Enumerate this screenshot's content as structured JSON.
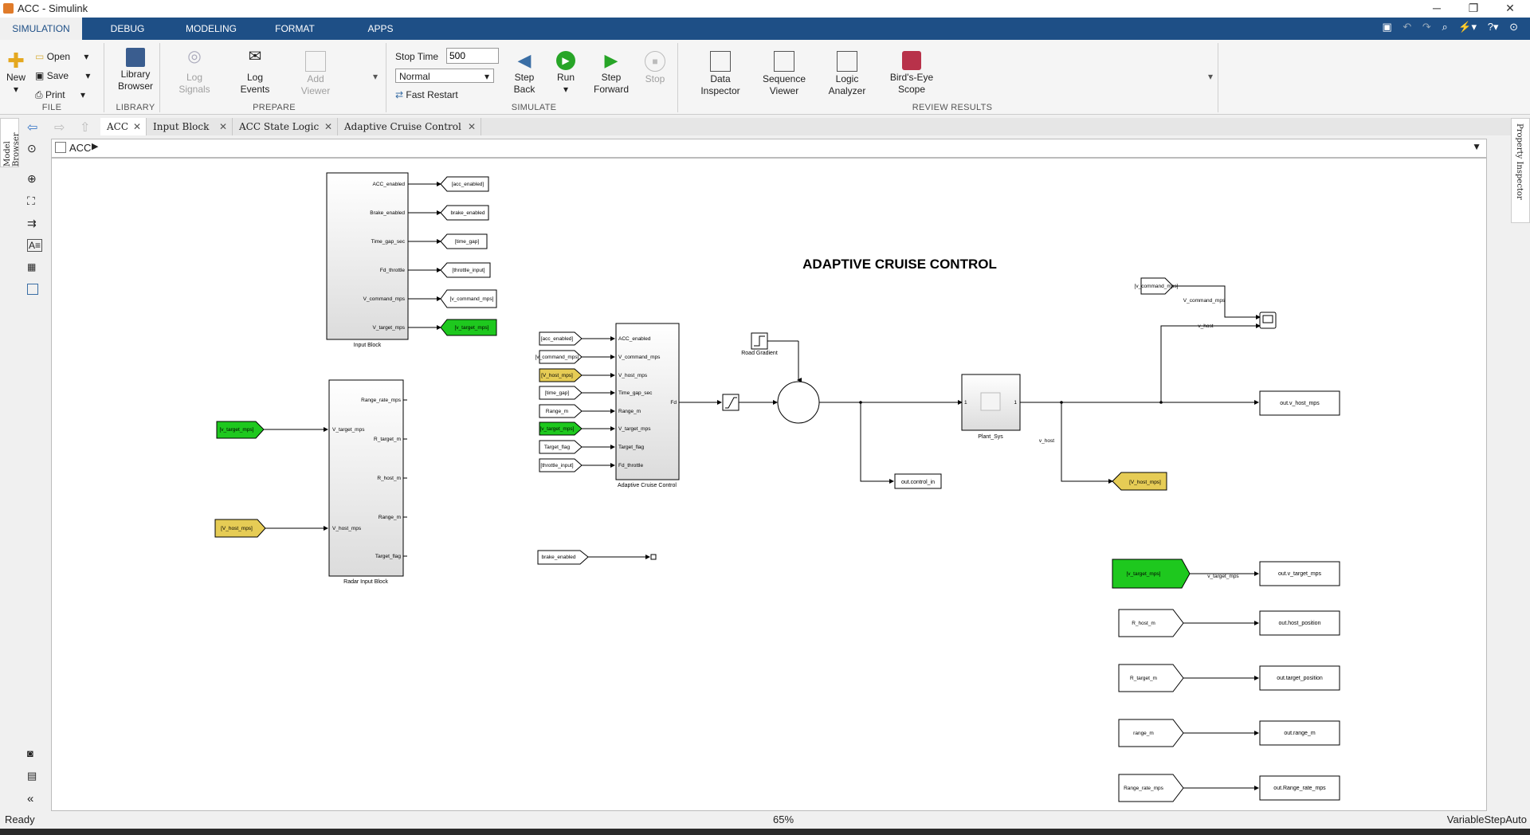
{
  "window": {
    "title": "ACC - Simulink",
    "min": "─",
    "restore": "❐",
    "close": "✕"
  },
  "tabs": [
    "SIMULATION",
    "DEBUG",
    "MODELING",
    "FORMAT",
    "APPS"
  ],
  "file": {
    "new": "New",
    "open": "Open",
    "save": "Save",
    "print": "Print",
    "title": "FILE"
  },
  "library": {
    "button": "Library Browser",
    "title": "LIBRARY"
  },
  "prepare": {
    "log_signals": "Log Signals",
    "log_events": "Log Events",
    "add_viewer": "Add Viewer",
    "title": "PREPARE"
  },
  "simulate": {
    "stop_time_label": "Stop Time",
    "stop_time_value": "500",
    "mode": "Normal",
    "fast_restart": "Fast Restart",
    "step_back": "Step Back",
    "run": "Run",
    "step_forward": "Step Forward",
    "stop": "Stop",
    "title": "SIMULATE"
  },
  "review": {
    "data_inspector": "Data Inspector",
    "sequence_viewer": "Sequence Viewer",
    "logic_analyzer": "Logic Analyzer",
    "birds_eye": "Bird's-Eye Scope",
    "title": "REVIEW RESULTS"
  },
  "editor_tabs": [
    "ACC",
    "Input Block",
    "ACC State Logic",
    "Adaptive Cruise Control"
  ],
  "breadcrumb": "ACC",
  "side_labels": {
    "model_browser": "Model Browser",
    "property_inspector": "Property Inspector"
  },
  "status": {
    "left": "Ready",
    "zoom": "65%",
    "solver": "VariableStepAuto"
  },
  "diagram": {
    "title": "ADAPTIVE CRUISE CONTROL",
    "input_block": {
      "name": "Input Block",
      "ports": [
        "ACC_enabled",
        "Brake_enabled",
        "Time_gap_sec",
        "Fd_throttle",
        "V_command_mps",
        "V_target_mps"
      ]
    },
    "input_gotos": [
      "[acc_enabled]",
      "brake_enabled",
      "[time_gap]",
      "[throttle_input]",
      "[v_command_mps]",
      "[v_target_mps]"
    ],
    "radar_block": {
      "name": "Radar Input Block",
      "inputs": [
        "V_target_mps",
        "V_host_mps"
      ],
      "outputs": [
        "Range_rate_mps",
        "R_target_m",
        "R_host_m",
        "Range_m",
        "Target_flag"
      ]
    },
    "radar_froms": [
      "[v_target_mps]",
      "[V_host_mps]"
    ],
    "acc_block": {
      "name": "Adaptive Cruise Control",
      "inputs": [
        "ACC_enabled",
        "V_command_mps",
        "V_host_mps",
        "Time_gap_sec",
        "Range_m",
        "V_target_mps",
        "Target_flag",
        "Fd_throttle"
      ],
      "output": "Fd"
    },
    "acc_froms": [
      "[acc_enabled]",
      "[v_command_mps]",
      "[V_host_mps]",
      "[time_gap]",
      "Range_m",
      "[v_target_mps]",
      "Target_flag",
      "[throttle_input]"
    ],
    "brake_from": "brake_enabled",
    "road_gradient": "Road Gradient",
    "plant": {
      "name": "Plant_Sys",
      "in": "1",
      "out": "1"
    },
    "out_control_in": "out.control_in",
    "scope_from": "[v_command_mps]",
    "sig_v_command": "V_command_mps",
    "sig_v_host": "v_host",
    "sig_v_host2": "v_host",
    "goto_v_host": "[V_host_mps]",
    "out_v_host": "out.v_host_mps",
    "from_v_target": "[v_target_mps]",
    "sig_v_target": "v_target_mps",
    "outs": [
      "out.v_target_mps",
      "out.host_position",
      "out.target_position",
      "out.range_m",
      "out.Range_rate_mps"
    ],
    "out_froms": [
      "R_host_m",
      "R_target_m",
      "range_m",
      "Range_rate_mps"
    ]
  },
  "colors": {
    "tab_bar": "#1e4f86",
    "green_tag": "#1ec81e",
    "yellow_tag": "#e6cc55"
  }
}
